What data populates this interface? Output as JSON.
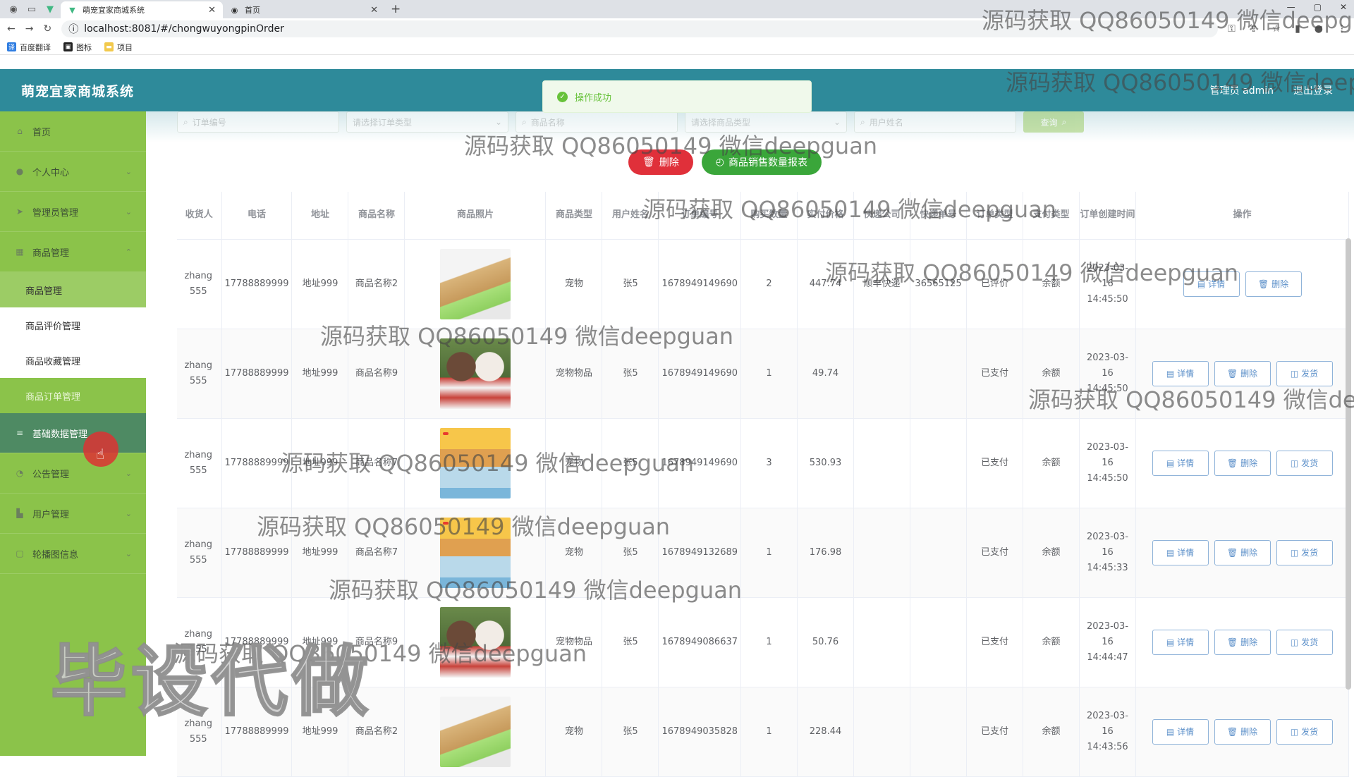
{
  "browser": {
    "tabs": [
      {
        "title": "萌宠宜家商城系统",
        "active": true
      },
      {
        "title": "首页",
        "active": false
      }
    ],
    "url": "localhost:8081/#/chongwuyongpinOrder",
    "bookmarks": [
      "百度翻译",
      "图标",
      "项目"
    ]
  },
  "header": {
    "title": "萌宠宜家商城系统",
    "user": "管理员 admin",
    "logout": "退出登录"
  },
  "toast": "操作成功",
  "sidebar": {
    "items": [
      {
        "label": "首页",
        "icon": "home-icon"
      },
      {
        "label": "个人中心",
        "icon": "user-icon"
      },
      {
        "label": "管理员管理",
        "icon": "send-icon"
      },
      {
        "label": "商品管理",
        "icon": "grid-icon"
      }
    ],
    "sub_items": [
      "商品管理",
      "商品评价管理",
      "商品收藏管理",
      "商品订单管理"
    ],
    "items_after": [
      {
        "label": "基础数据管理",
        "icon": "data-icon"
      },
      {
        "label": "公告管理",
        "icon": "notice-icon"
      },
      {
        "label": "用户管理",
        "icon": "user-group-icon"
      },
      {
        "label": "轮播图信息",
        "icon": "image-icon"
      }
    ]
  },
  "search": {
    "order_no": "订单编号",
    "order_type": "请选择订单类型",
    "goods_name": "商品名称",
    "goods_type": "请选择商品类型",
    "user_name": "用户姓名",
    "query": "查询"
  },
  "actions": {
    "delete": "删除",
    "report": "商品销售数量报表"
  },
  "table": {
    "headers": [
      "收货人",
      "电话",
      "地址",
      "商品名称",
      "商品照片",
      "商品类型",
      "用户姓名",
      "订单编号",
      "购买数量",
      "实付价格",
      "快递公司",
      "快递单号",
      "订单类型",
      "支付类型",
      "订单创建时间",
      "操作"
    ],
    "rows": [
      {
        "receiver": "zhang 555",
        "phone": "17788889999",
        "address": "地址999",
        "goods": "商品名称2",
        "photo": "dog",
        "goods_type": "宠物",
        "user": "张5",
        "order_no": "1678949149690",
        "qty": "2",
        "price": "447.74",
        "courier": "顺丰快递",
        "tracking": "36565125",
        "order_type": "已评价",
        "pay_type": "余额",
        "created": "2023-03-16 14:45:50",
        "ops": [
          "详情",
          "删除"
        ]
      },
      {
        "receiver": "zhang 555",
        "phone": "17788889999",
        "address": "地址999",
        "goods": "商品名称9",
        "photo": "poodle",
        "goods_type": "宠物物品",
        "user": "张5",
        "order_no": "1678949149690",
        "qty": "1",
        "price": "49.74",
        "courier": "",
        "tracking": "",
        "order_type": "已支付",
        "pay_type": "余额",
        "created": "2023-03-16 14:45:50",
        "ops": [
          "详情",
          "删除",
          "发货"
        ]
      },
      {
        "receiver": "zhang 555",
        "phone": "17788889999",
        "address": "地址999",
        "goods": "商品名称7",
        "photo": "tray",
        "goods_type": "宠物",
        "user": "张5",
        "order_no": "1678949149690",
        "qty": "3",
        "price": "530.93",
        "courier": "",
        "tracking": "",
        "order_type": "已支付",
        "pay_type": "余额",
        "created": "2023-03-16 14:45:50",
        "ops": [
          "详情",
          "删除",
          "发货"
        ]
      },
      {
        "receiver": "zhang 555",
        "phone": "17788889999",
        "address": "地址999",
        "goods": "商品名称7",
        "photo": "tray",
        "goods_type": "宠物",
        "user": "张5",
        "order_no": "1678949132689",
        "qty": "1",
        "price": "176.98",
        "courier": "",
        "tracking": "",
        "order_type": "已支付",
        "pay_type": "余额",
        "created": "2023-03-16 14:45:33",
        "ops": [
          "详情",
          "删除",
          "发货"
        ]
      },
      {
        "receiver": "zhang 555",
        "phone": "17788889999",
        "address": "地址999",
        "goods": "商品名称9",
        "photo": "poodle",
        "goods_type": "宠物物品",
        "user": "张5",
        "order_no": "1678949086637",
        "qty": "1",
        "price": "50.76",
        "courier": "",
        "tracking": "",
        "order_type": "已支付",
        "pay_type": "余额",
        "created": "2023-03-16 14:44:47",
        "ops": [
          "详情",
          "删除",
          "发货"
        ]
      },
      {
        "receiver": "zhang 555",
        "phone": "17788889999",
        "address": "地址999",
        "goods": "商品名称2",
        "photo": "dog",
        "goods_type": "宠物",
        "user": "张5",
        "order_no": "1678949035828",
        "qty": "1",
        "price": "228.44",
        "courier": "",
        "tracking": "",
        "order_type": "已支付",
        "pay_type": "余额",
        "created": "2023-03-16 14:43:56",
        "ops": [
          "详情",
          "删除",
          "发货"
        ]
      }
    ]
  },
  "watermarks": {
    "text": "源码获取 QQ86050149 微信deepguan",
    "big": "毕设代做"
  },
  "colors": {
    "header": "#2e8a9a",
    "sidebar": "#8bc34a",
    "delete_button": "#e0303a",
    "report_button": "#3aa63a",
    "toast": "#67c23a"
  }
}
